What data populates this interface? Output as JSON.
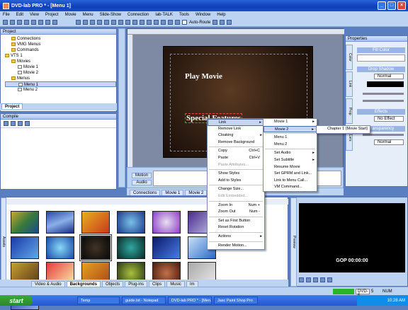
{
  "window": {
    "title": "DVD-lab PRO * - [Menu 1]"
  },
  "menubar": [
    "File",
    "Edit",
    "View",
    "Project",
    "Movie",
    "Menu",
    "Slide-Show",
    "Connection",
    "lab-TALK",
    "Tools",
    "Window",
    "Help"
  ],
  "toolbar": {
    "autoroute_label": "Auto-Route"
  },
  "project_panel": {
    "title": "Project",
    "tree": [
      {
        "label": "Connections",
        "level": 1,
        "kind": "folder"
      },
      {
        "label": "VMG Menus",
        "level": 1,
        "kind": "folder"
      },
      {
        "label": "Commands",
        "level": 1,
        "kind": "folder"
      },
      {
        "label": "VTS 1",
        "level": 0,
        "kind": "folder"
      },
      {
        "label": "Movies",
        "level": 1,
        "kind": "folder"
      },
      {
        "label": "Movie 1",
        "level": 2,
        "kind": "file"
      },
      {
        "label": "Movie 2",
        "level": 2,
        "kind": "file"
      },
      {
        "label": "Menus",
        "level": 1,
        "kind": "folder"
      },
      {
        "label": "Menu 1",
        "level": 2,
        "kind": "file",
        "selected": true
      },
      {
        "label": "Menu 2",
        "level": 2,
        "kind": "file"
      }
    ],
    "tab": "Project"
  },
  "compile_panel": {
    "title": "Compile"
  },
  "canvas": {
    "button_play": "Play Movie",
    "button_special": "Special Features"
  },
  "timeline": {
    "motion_label": "Motion",
    "audio_label": "Audio"
  },
  "doc_tabs": [
    "Connections",
    "Movie 1",
    "Movie 2"
  ],
  "context_menu": [
    {
      "label": "Link",
      "arrow": true,
      "selected": true
    },
    {
      "label": "Remove Link"
    },
    {
      "label": "Cloaking",
      "arrow": true
    },
    {
      "label": "Remove Background"
    },
    {
      "sep": true
    },
    {
      "label": "Copy",
      "shortcut": "Ctrl+C"
    },
    {
      "label": "Paste",
      "shortcut": "Ctrl+V"
    },
    {
      "label": "Paste Attributes...",
      "disabled": true
    },
    {
      "sep": true
    },
    {
      "label": "Show Styles"
    },
    {
      "label": "Add to Styles"
    },
    {
      "sep": true
    },
    {
      "label": "Change Size..."
    },
    {
      "label": "Edit Embedded...",
      "disabled": true
    },
    {
      "sep": true
    },
    {
      "label": "Zoom In",
      "shortcut": "Num +"
    },
    {
      "label": "Zoom Out",
      "shortcut": "Num -"
    },
    {
      "sep": true
    },
    {
      "label": "Set as First Button"
    },
    {
      "label": "Reset Rotation"
    },
    {
      "sep": true
    },
    {
      "label": "Actions",
      "arrow": true
    },
    {
      "sep": true
    },
    {
      "label": "Render Motion..."
    }
  ],
  "link_submenu": [
    {
      "label": "Movie 1",
      "arrow": true
    },
    {
      "label": "Movie 2",
      "arrow": true,
      "selected": true
    },
    {
      "sep": true
    },
    {
      "label": "Menu 1"
    },
    {
      "label": "Menu 2"
    },
    {
      "sep": true
    },
    {
      "label": "Set Audio",
      "arrow": true
    },
    {
      "label": "Set Subtitle",
      "arrow": true
    },
    {
      "label": "Resume Movie"
    },
    {
      "label": "Set GPRM and Link..."
    },
    {
      "label": "Link to Menu Call..."
    },
    {
      "label": "VM Command..."
    }
  ],
  "chapter_submenu": [
    {
      "label": "Chapter 1 (Movie Start)"
    }
  ],
  "properties_panel": {
    "title": "Properties",
    "fill_color": "Fill Color",
    "drop_shadow": "Drop Shadow",
    "shadow_mode": "Normal",
    "effects": "Effects",
    "effect_value": "No Effect",
    "transparency": "Transparency",
    "opacity_mode": "Normal",
    "side_tabs": [
      "Color",
      "Link",
      "Prop",
      "Lvrs"
    ]
  },
  "assets_panel": {
    "title": "Assets",
    "tabs": [
      "Video & Audio",
      "Backgrounds",
      "Objects",
      "Plug-ins",
      "Clips",
      "Music",
      "Im"
    ],
    "active_tab": "Backgrounds"
  },
  "preview": {
    "gop_label": "GOP 00:00:00",
    "side_label": "Preview"
  },
  "status": {
    "disk": "DVD-5",
    "mode": "NUM",
    "size": "5"
  },
  "taskbar": {
    "start": "start",
    "tasks": [
      "Temp",
      "guide.txt - Notepad",
      "DVD-lab PRO * - [Men...",
      "Jasc Paint Shop Pro"
    ],
    "clock": "10:28 AM"
  },
  "colors": {
    "titlebar": "#0d3fb8",
    "chrome": "#bcd3f2",
    "canvas_bg": "#2a1c14",
    "button_text": "#ffffff"
  }
}
